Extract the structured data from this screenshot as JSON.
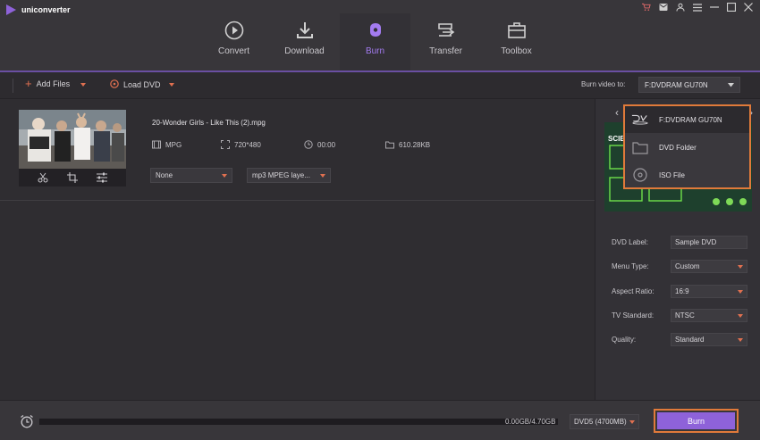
{
  "app": {
    "title": "uniconverter"
  },
  "nav": {
    "tabs": [
      {
        "label": "Convert",
        "icon": "play-circle-icon"
      },
      {
        "label": "Download",
        "icon": "download-icon"
      },
      {
        "label": "Burn",
        "icon": "disc-burn-icon",
        "active": true
      },
      {
        "label": "Transfer",
        "icon": "transfer-icon"
      },
      {
        "label": "Toolbox",
        "icon": "toolbox-icon"
      }
    ]
  },
  "toolbar": {
    "add_files": "Add Files",
    "load_dvd": "Load DVD",
    "burn_video_to": "Burn video to:",
    "target": "F:DVDRAM GU70N"
  },
  "file": {
    "name": "20-Wonder Girls - Like This (2).mpg",
    "format": "MPG",
    "resolution": "720*480",
    "duration": "00:00",
    "size": "610.28KB",
    "subtitle": "None",
    "audio": "mp3 MPEG laye..."
  },
  "popup": {
    "items": [
      {
        "label": "F:DVDRAM GU70N",
        "icon": "dvd-icon"
      },
      {
        "label": "DVD Folder",
        "icon": "folder-icon"
      },
      {
        "label": "ISO File",
        "icon": "iso-disc-icon"
      }
    ]
  },
  "settings": {
    "dvd_label": {
      "label": "DVD Label:",
      "value": "Sample DVD"
    },
    "menu_type": {
      "label": "Menu Type:",
      "value": "Custom"
    },
    "aspect_ratio": {
      "label": "Aspect Ratio:",
      "value": "16:9"
    },
    "tv_standard": {
      "label": "TV Standard:",
      "value": "NTSC"
    },
    "quality": {
      "label": "Quality:",
      "value": "Standard"
    }
  },
  "preview": {
    "text": "SCIE"
  },
  "bottom": {
    "progress_text": "0.00GB/4.70GB",
    "progress_fraction": 0.0,
    "disc_type": "DVD5 (4700MB)",
    "burn_label": "Burn"
  },
  "colors": {
    "accent": "#8e62d9",
    "highlight": "#e07a3a",
    "caret": "#e07050"
  }
}
